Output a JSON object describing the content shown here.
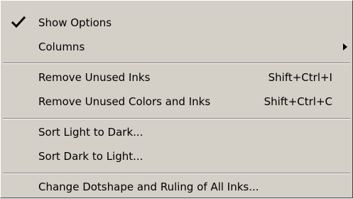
{
  "menu": {
    "items": [
      {
        "label": "Show Options",
        "checked": true,
        "icon": "checkmark-icon"
      },
      {
        "label": "Columns",
        "submenu": true,
        "icon": "submenu-arrow-icon"
      },
      {
        "label": "Remove Unused Inks",
        "shortcut": "Shift+Ctrl+I"
      },
      {
        "label": "Remove Unused Colors and Inks",
        "shortcut": "Shift+Ctrl+C"
      },
      {
        "label": "Sort Light to Dark..."
      },
      {
        "label": "Sort Dark to Light..."
      },
      {
        "label": "Change Dotshape and Ruling of All Inks..."
      }
    ]
  },
  "colors": {
    "menu_background": "#d4d0c8",
    "separator_shadow": "#808080",
    "separator_highlight": "#ffffff",
    "text": "#000000"
  }
}
